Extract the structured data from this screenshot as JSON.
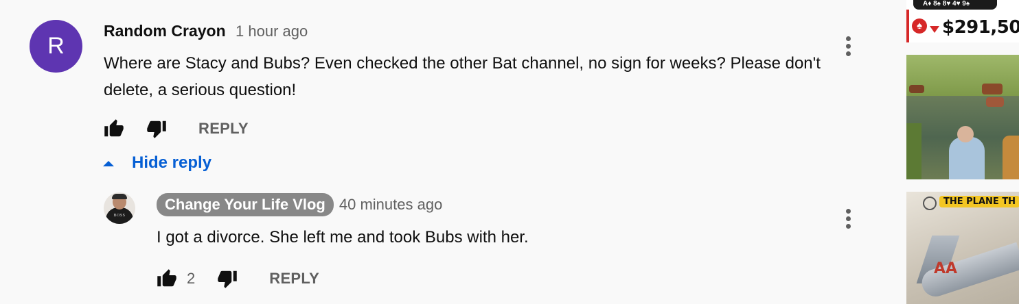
{
  "comment": {
    "avatar_letter": "R",
    "author": "Random Crayon",
    "time": "1 hour ago",
    "text": "Where are Stacy and Bubs? Even checked the other Bat channel, no sign for weeks? Please don't delete, a serious question!",
    "reply_label": "REPLY",
    "avatar_color": "#5e35b1"
  },
  "hide_reply": {
    "label": "Hide reply"
  },
  "reply": {
    "author": "Change Your Life Vlog",
    "time": "40 minutes ago",
    "text": "I got a divorce. She left me and took Bubs with her.",
    "like_count": "2",
    "reply_label": "REPLY",
    "avatar_shirt_text": "BOSS"
  },
  "sidebar": {
    "thumb1": {
      "cards": "A♦ 8♠ 8♥ 4♥ 9♠",
      "suit_icon": "spade-icon",
      "amount": "$291,50"
    },
    "thumb3": {
      "banner": "THE PLANE TH",
      "plane_logo": "AA"
    }
  },
  "colors": {
    "link_blue": "#065fd4",
    "secondary_text": "#606060",
    "owner_badge": "#888888",
    "background": "#f9f9f9"
  }
}
